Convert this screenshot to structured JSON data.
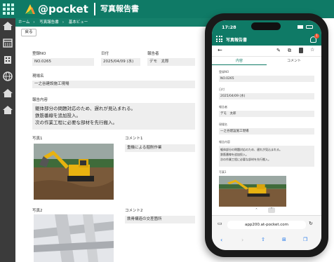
{
  "header": {
    "logo_text": "@pocket",
    "app_title": "写真報告書"
  },
  "breadcrumb": [
    "ホーム",
    "写真報告書",
    "基本ビュー"
  ],
  "back_label": "戻る",
  "form": {
    "reg_no_label": "登録NO",
    "reg_no": "NO.0265",
    "date_label": "日付",
    "date": "2025/04/09 (水)",
    "reporter_label": "報告者",
    "reporter": "デモ　太郎",
    "site_label": "現場名",
    "site": "一之谷建設施工現場",
    "report_label": "報告内容",
    "report_lines": [
      "躯体部分の問題対応のため、遅れが見込まれる。",
      "鉄筋番線を追加投入。",
      "次の作業工程に必要な部材を先行搬入。"
    ],
    "photo1_label": "写真1",
    "comment1_label": "コメント1",
    "comment1": "重機による掘削作業",
    "photo2_label": "写真2",
    "comment2_label": "コメント2",
    "comment2": "鉄骨構造の交差箇所"
  },
  "phone": {
    "time": "17:28",
    "app_title": "写真報告書",
    "badge": "1",
    "tab_content": "内容",
    "tab_comment": "コメント",
    "reg_no_label": "登録NO",
    "reg_no": "NO.0265",
    "date_label": "日付",
    "date": "2025/04/09 (水)",
    "reporter_label": "報告者",
    "reporter": "デモ　太郎",
    "site_label": "現場名",
    "site": "一之谷建設施工現場",
    "report_label": "報告内容",
    "report_lines": [
      "躯体部分の問題対応のため、遅れが見込まれる。",
      "鉄筋番線を追加投入。",
      "次の作業工程に必要な部材を先行搬入。"
    ],
    "photo1_label": "写真1",
    "url": "app200.at-pocket.com"
  },
  "colors": {
    "brand": "#0f7a66",
    "sidebar": "#3b3b3b"
  },
  "icons": [
    "grid-icon",
    "home-icon",
    "calendar-icon",
    "building-icon",
    "globe-icon",
    "home-icon",
    "home-icon"
  ]
}
